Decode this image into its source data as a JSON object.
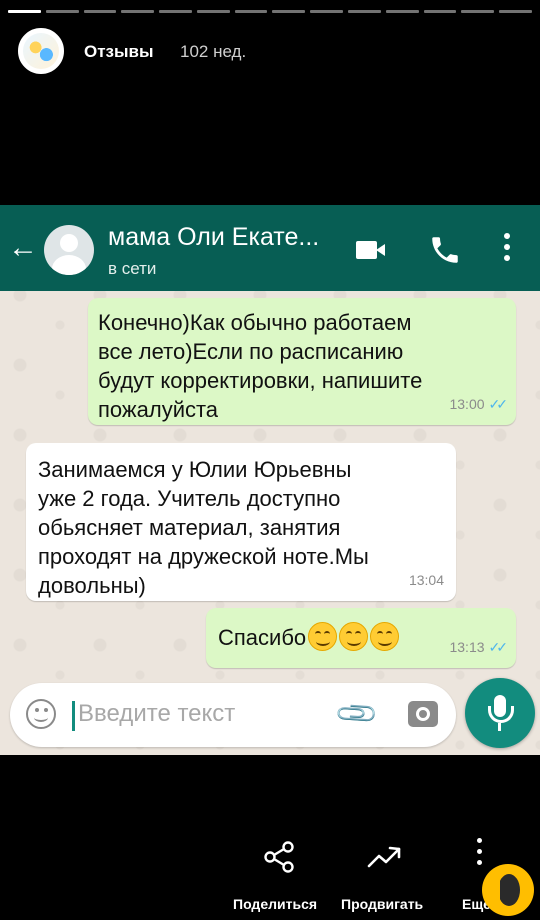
{
  "story": {
    "segments_total": 14,
    "segments_done": 1,
    "title": "Отзывы",
    "time": "102 нед."
  },
  "chat": {
    "contact_name": "мама Оли Екате...",
    "contact_status": "в сети",
    "messages": [
      {
        "direction": "out",
        "text": "Конечно)Как обычно работаем\nвсе лето)Если по расписанию\nбудут корректировки, напишите\nпожалуйста",
        "time": "13:00",
        "read": true
      },
      {
        "direction": "in",
        "text": "Занимаемся у Юлии Юрьевны\nуже 2 года. Учитель доступно\nобьясняет материал, занятия\nпроходят на дружеской ноте.Мы\nдовольны)",
        "time": "13:04"
      },
      {
        "direction": "out",
        "text": "Спасибо",
        "emoji_count": 3,
        "time": "13:13",
        "read": true
      }
    ],
    "input": {
      "placeholder": "Введите текст"
    },
    "icons": {
      "back": "arrow-back-icon",
      "video": "video-call-icon",
      "phone": "phone-call-icon",
      "menu": "more-vert-icon",
      "emoji": "emoji-icon",
      "attach": "paperclip-icon",
      "camera": "camera-icon",
      "mic": "microphone-icon"
    },
    "colors": {
      "header": "#075e54",
      "outgoing": "#dcf8c6",
      "incoming": "#ffffff",
      "accent": "#128c7e",
      "read_ticks": "#4fb6ec"
    }
  },
  "actions": {
    "share": "Поделиться",
    "promote": "Продвигать",
    "more": "Ещё"
  }
}
